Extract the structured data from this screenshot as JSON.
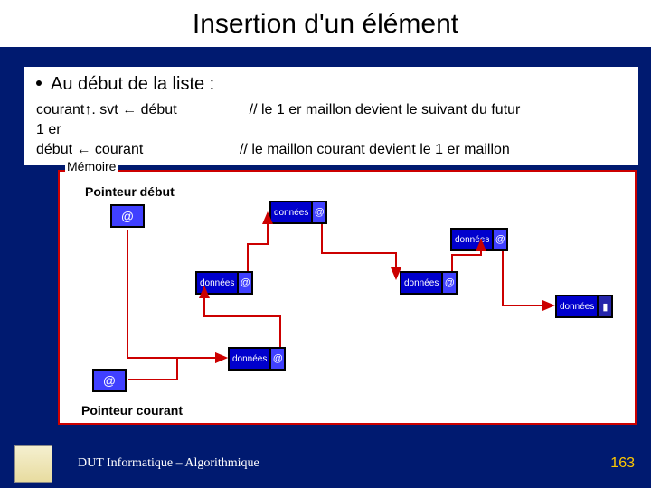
{
  "title": "Insertion d'un élément",
  "bullet": "Au début de la liste :",
  "lines": {
    "l1_left": "courant↑. svt ← début",
    "l1_right": "// le 1 er maillon devient le suivant du futur",
    "l2": "1 er",
    "l3_left": "début ← courant",
    "l3_right": "// le maillon courant devient le 1 er maillon"
  },
  "mem": {
    "label": "Mémoire",
    "ptr_start": "Pointeur début",
    "ptr_current": "Pointeur courant",
    "at": "@",
    "data": "données"
  },
  "footer": {
    "course": "DUT Informatique – Algorithmique",
    "page": "163"
  }
}
